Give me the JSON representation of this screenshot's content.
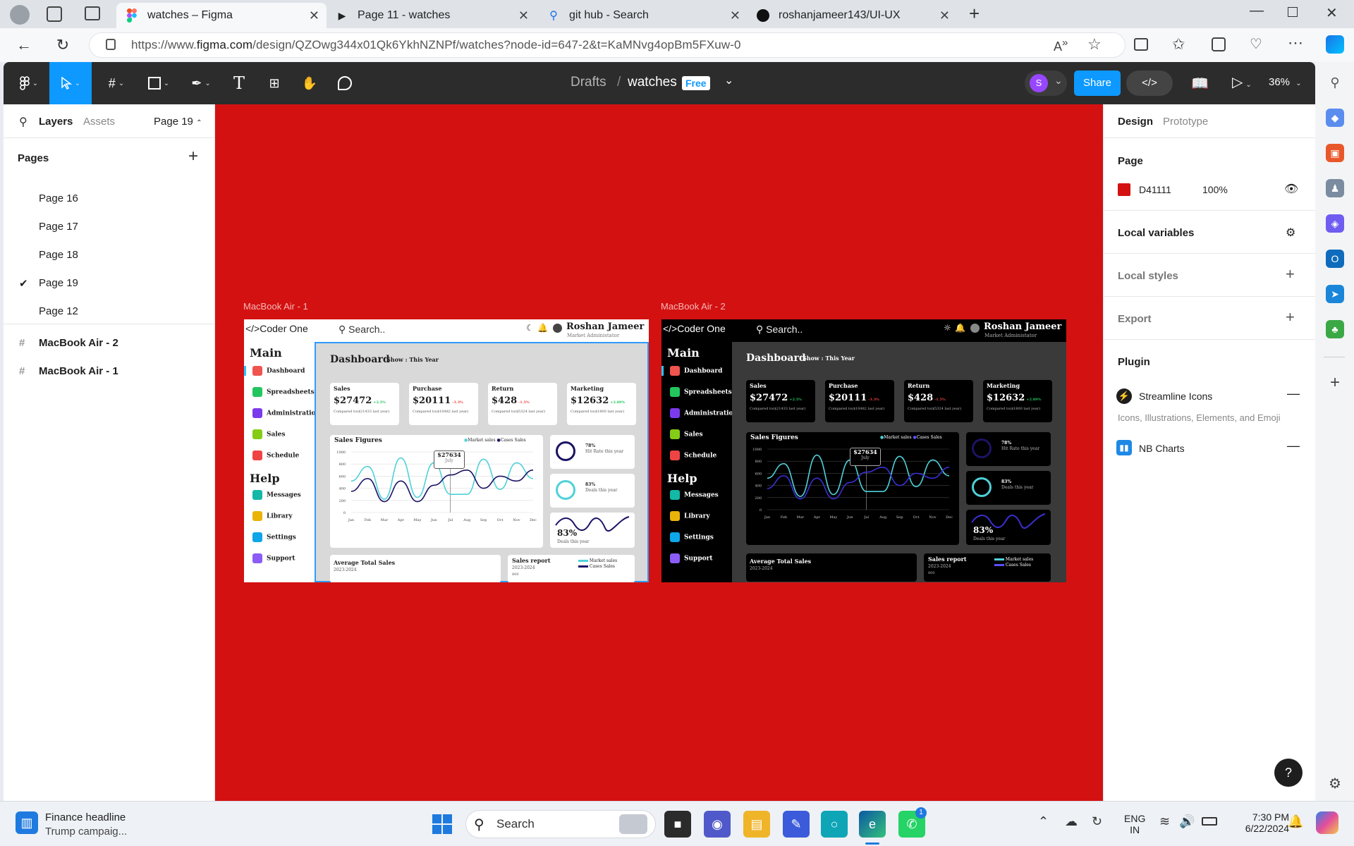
{
  "browser": {
    "tabs": [
      {
        "title": "watches – Figma",
        "icon": "figma-icon",
        "active": true
      },
      {
        "title": "Page 11 - watches",
        "icon": "play-icon",
        "active": false
      },
      {
        "title": "git hub - Search",
        "icon": "search-icon",
        "active": false
      },
      {
        "title": "roshanjameer143/UI-UX",
        "icon": "github-icon",
        "active": false
      }
    ],
    "url_prefix": "https://www.",
    "url_domain": "figma.com",
    "url_rest": "/design/QZOwg344x01Qk6YkhNZNPf/watches?node-id=647-2&t=KaMNvg4opBm5FXuw-0"
  },
  "figma": {
    "breadcrumb_drafts": "Drafts",
    "breadcrumb_sep": "/",
    "file_name": "watches",
    "plan_badge": "Free",
    "avatar_letter": "S",
    "share_label": "Share",
    "zoom": "36%",
    "left": {
      "tab_layers": "Layers",
      "tab_assets": "Assets",
      "current_page": "Page 19",
      "pages_title": "Pages",
      "pages": [
        "Page 16",
        "Page 17",
        "Page 18",
        "Page 19",
        "Page 12"
      ],
      "selected_page_index": 3,
      "layers": [
        "MacBook Air - 2",
        "MacBook Air - 1"
      ]
    },
    "right": {
      "tab_design": "Design",
      "tab_prototype": "Prototype",
      "page_title": "Page",
      "page_color_hex": "D41111",
      "page_color": "#d41111",
      "page_opacity": "100%",
      "local_variables": "Local variables",
      "local_styles": "Local styles",
      "export": "Export",
      "plugin_title": "Plugin",
      "plugins": [
        {
          "name": "Streamline Icons",
          "desc": "Icons, Illustrations, Elements, and Emoji"
        },
        {
          "name": "NB Charts",
          "desc": ""
        }
      ]
    },
    "help_button": "?"
  },
  "mockup": {
    "frame1_label": "MacBook Air - 1",
    "frame2_label": "MacBook Air - 2",
    "logo": "</>Coder One",
    "search": "Search..",
    "user_name": "Roshan Jameer",
    "user_role": "Market Administator",
    "main_heading": "Main",
    "help_heading": "Help",
    "main_items": [
      "Dashboard",
      "Spreadsheets",
      "Administration",
      "Sales",
      "Schedule"
    ],
    "help_items": [
      "Messages",
      "Library",
      "Settings",
      "Support"
    ],
    "dashboard_title": "Dashboard",
    "show_label": "Show : This Year",
    "stats": [
      {
        "label": "Sales",
        "value": "$27472",
        "change": "+2.5%",
        "note": "Compared to($21433 last year)"
      },
      {
        "label": "Purchase",
        "value": "$20111",
        "change": "-3.3%",
        "note": "Compared to($10482 last year)"
      },
      {
        "label": "Return",
        "value": "$428",
        "change": "-1.5%",
        "note": "Compared to($5324 last year)"
      },
      {
        "label": "Marketing",
        "value": "$12632",
        "change": "+2.89%",
        "note": "Compared to($1800 last year)"
      }
    ],
    "sales_figures_title": "Sales Figures",
    "legend_market": "Market sales",
    "legend_cases": "Cases Sales",
    "tooltip_value": "$27634",
    "tooltip_month": "July",
    "side_stats": [
      {
        "value": "78%",
        "label": "Hit Rate this year"
      },
      {
        "value": "83%",
        "label": "Deals this year"
      },
      {
        "value": "83%",
        "label": "Deals this year"
      }
    ],
    "avg_sales_title": "Average Total Sales",
    "avg_sales_years": "2023-2024",
    "report_title": "Sales report",
    "report_years": "2023-2024",
    "report_axis": "800"
  },
  "chart_data": {
    "type": "line",
    "title": "Sales Figures",
    "categories": [
      "Jan",
      "Feb",
      "Mar",
      "Apr",
      "May",
      "Jun",
      "Jul",
      "Aug",
      "Sep",
      "Oct",
      "Nov",
      "Dec"
    ],
    "yticks": [
      1000,
      800,
      600,
      400,
      200,
      0
    ],
    "ylim": [
      0,
      1000
    ],
    "series": [
      {
        "name": "Market sales",
        "color": "#4fd1d9",
        "values": [
          520,
          760,
          220,
          900,
          250,
          820,
          300,
          300,
          880,
          380,
          820,
          560
        ]
      },
      {
        "name": "Cases Sales",
        "color": "#1b1464",
        "values": [
          350,
          560,
          180,
          520,
          180,
          450,
          620,
          700,
          400,
          600,
          520,
          700
        ]
      }
    ]
  },
  "taskbar": {
    "news_title": "Finance headline",
    "news_sub": "Trump campaig...",
    "search": "Search",
    "lang1": "ENG",
    "lang2": "IN",
    "time": "7:30 PM",
    "date": "6/22/2024",
    "whatsapp_badge": "1"
  }
}
